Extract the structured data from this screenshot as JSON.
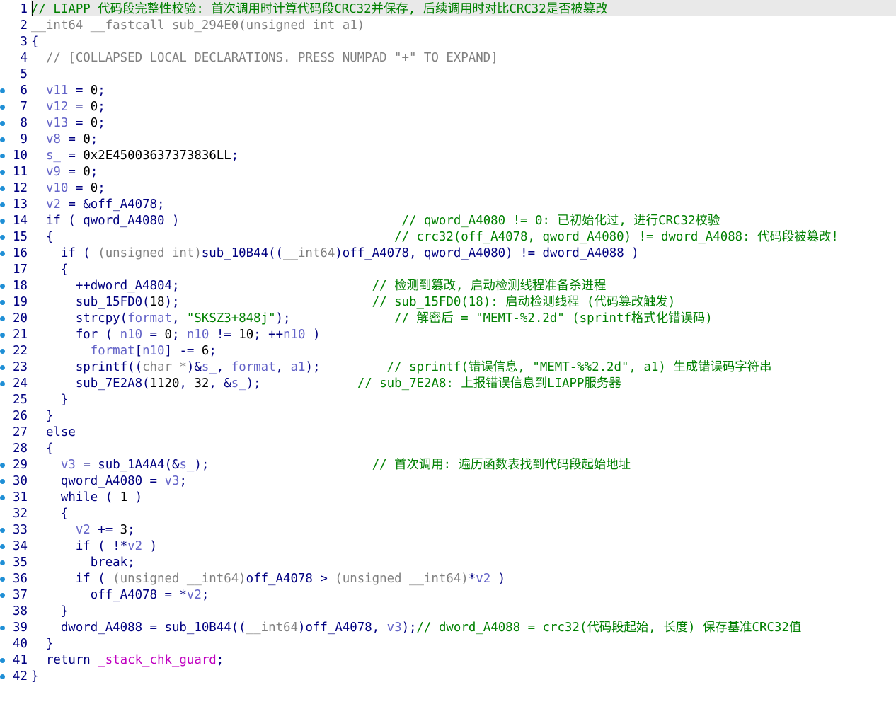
{
  "lines": [
    {
      "n": "1",
      "bp": false,
      "tokens": [
        {
          "t": "// LIAPP 代码段完整性校验: 首次调用时计算代码段CRC32并保存, 后续调用时对比CRC32是否被篡改",
          "c": "c"
        }
      ]
    },
    {
      "n": "2",
      "bp": false,
      "tokens": [
        {
          "t": "__int64 __fastcall sub_294E0(unsigned int a1)",
          "c": "t"
        }
      ]
    },
    {
      "n": "3",
      "bp": false,
      "tokens": [
        {
          "t": "{",
          "c": "p"
        }
      ]
    },
    {
      "n": "4",
      "bp": false,
      "tokens": [
        {
          "t": "  // [COLLAPSED LOCAL DECLARATIONS. PRESS NUMPAD \"+\" TO EXPAND]",
          "c": "t"
        }
      ]
    },
    {
      "n": "5",
      "bp": false,
      "tokens": []
    },
    {
      "n": "6",
      "bp": true,
      "tokens": [
        {
          "t": "  ",
          "c": "p"
        },
        {
          "t": "v11",
          "c": "v"
        },
        {
          "t": " = ",
          "c": "p"
        },
        {
          "t": "0",
          "c": "n"
        },
        {
          "t": ";",
          "c": "p"
        }
      ]
    },
    {
      "n": "7",
      "bp": true,
      "tokens": [
        {
          "t": "  ",
          "c": "p"
        },
        {
          "t": "v12",
          "c": "v"
        },
        {
          "t": " = ",
          "c": "p"
        },
        {
          "t": "0",
          "c": "n"
        },
        {
          "t": ";",
          "c": "p"
        }
      ]
    },
    {
      "n": "8",
      "bp": true,
      "tokens": [
        {
          "t": "  ",
          "c": "p"
        },
        {
          "t": "v13",
          "c": "v"
        },
        {
          "t": " = ",
          "c": "p"
        },
        {
          "t": "0",
          "c": "n"
        },
        {
          "t": ";",
          "c": "p"
        }
      ]
    },
    {
      "n": "9",
      "bp": true,
      "tokens": [
        {
          "t": "  ",
          "c": "p"
        },
        {
          "t": "v8",
          "c": "v"
        },
        {
          "t": " = ",
          "c": "p"
        },
        {
          "t": "0",
          "c": "n"
        },
        {
          "t": ";",
          "c": "p"
        }
      ]
    },
    {
      "n": "10",
      "bp": true,
      "tokens": [
        {
          "t": "  ",
          "c": "p"
        },
        {
          "t": "s_",
          "c": "v"
        },
        {
          "t": " = ",
          "c": "p"
        },
        {
          "t": "0x2E45003637373836LL",
          "c": "n"
        },
        {
          "t": ";",
          "c": "p"
        }
      ]
    },
    {
      "n": "11",
      "bp": true,
      "tokens": [
        {
          "t": "  ",
          "c": "p"
        },
        {
          "t": "v9",
          "c": "v"
        },
        {
          "t": " = ",
          "c": "p"
        },
        {
          "t": "0",
          "c": "n"
        },
        {
          "t": ";",
          "c": "p"
        }
      ]
    },
    {
      "n": "12",
      "bp": true,
      "tokens": [
        {
          "t": "  ",
          "c": "p"
        },
        {
          "t": "v10",
          "c": "v"
        },
        {
          "t": " = ",
          "c": "p"
        },
        {
          "t": "0",
          "c": "n"
        },
        {
          "t": ";",
          "c": "p"
        }
      ]
    },
    {
      "n": "13",
      "bp": true,
      "tokens": [
        {
          "t": "  ",
          "c": "p"
        },
        {
          "t": "v2",
          "c": "v"
        },
        {
          "t": " = &",
          "c": "p"
        },
        {
          "t": "off_A4078",
          "c": "g"
        },
        {
          "t": ";",
          "c": "p"
        }
      ]
    },
    {
      "n": "14",
      "bp": true,
      "tokens": [
        {
          "t": "  if ( ",
          "c": "p"
        },
        {
          "t": "qword_A4080",
          "c": "g"
        },
        {
          "t": " )",
          "c": "p"
        },
        {
          "t": "                              ",
          "c": "p"
        },
        {
          "t": "// qword_A4080 != 0: 已初始化过, 进行CRC32校验",
          "c": "s"
        }
      ]
    },
    {
      "n": "15",
      "bp": true,
      "tokens": [
        {
          "t": "  {",
          "c": "p"
        },
        {
          "t": "                                              ",
          "c": "p"
        },
        {
          "t": "// crc32(off_A4078, qword_A4080) != dword_A4088: 代码段被篡改!",
          "c": "s"
        }
      ]
    },
    {
      "n": "16",
      "bp": true,
      "tokens": [
        {
          "t": "    if ( ",
          "c": "p"
        },
        {
          "t": "(unsigned int)",
          "c": "t"
        },
        {
          "t": "sub_10B44",
          "c": "p"
        },
        {
          "t": "((",
          "c": "p"
        },
        {
          "t": "__int64",
          "c": "t"
        },
        {
          "t": ")",
          "c": "p"
        },
        {
          "t": "off_A4078",
          "c": "g"
        },
        {
          "t": ", ",
          "c": "p"
        },
        {
          "t": "qword_A4080",
          "c": "g"
        },
        {
          "t": ") != ",
          "c": "p"
        },
        {
          "t": "dword_A4088",
          "c": "g"
        },
        {
          "t": " )",
          "c": "p"
        }
      ]
    },
    {
      "n": "17",
      "bp": false,
      "tokens": [
        {
          "t": "    {",
          "c": "p"
        }
      ]
    },
    {
      "n": "18",
      "bp": true,
      "tokens": [
        {
          "t": "      ++",
          "c": "p"
        },
        {
          "t": "dword_A4804",
          "c": "g"
        },
        {
          "t": ";",
          "c": "p"
        },
        {
          "t": "                          ",
          "c": "p"
        },
        {
          "t": "// 检测到篡改, 启动检测线程准备杀进程",
          "c": "s"
        }
      ]
    },
    {
      "n": "19",
      "bp": true,
      "tokens": [
        {
          "t": "      sub_15FD0(",
          "c": "p"
        },
        {
          "t": "18",
          "c": "n"
        },
        {
          "t": ");",
          "c": "p"
        },
        {
          "t": "                          ",
          "c": "p"
        },
        {
          "t": "// sub_15FD0(18): 启动检测线程 (代码篡改触发)",
          "c": "s"
        }
      ]
    },
    {
      "n": "20",
      "bp": true,
      "tokens": [
        {
          "t": "      strcpy(",
          "c": "p"
        },
        {
          "t": "format",
          "c": "v"
        },
        {
          "t": ", ",
          "c": "p"
        },
        {
          "t": "\"SKSZ3+848j\"",
          "c": "s"
        },
        {
          "t": ");",
          "c": "p"
        },
        {
          "t": "              ",
          "c": "p"
        },
        {
          "t": "// 解密后 = \"MEMT-%2.2d\" (sprintf格式化错误码)",
          "c": "s"
        }
      ]
    },
    {
      "n": "21",
      "bp": true,
      "tokens": [
        {
          "t": "      for ( ",
          "c": "p"
        },
        {
          "t": "n10",
          "c": "v"
        },
        {
          "t": " = ",
          "c": "p"
        },
        {
          "t": "0",
          "c": "n"
        },
        {
          "t": "; ",
          "c": "p"
        },
        {
          "t": "n10",
          "c": "v"
        },
        {
          "t": " != ",
          "c": "p"
        },
        {
          "t": "10",
          "c": "n"
        },
        {
          "t": "; ++",
          "c": "p"
        },
        {
          "t": "n10",
          "c": "v"
        },
        {
          "t": " )",
          "c": "p"
        }
      ]
    },
    {
      "n": "22",
      "bp": true,
      "tokens": [
        {
          "t": "        ",
          "c": "p"
        },
        {
          "t": "format",
          "c": "v"
        },
        {
          "t": "[",
          "c": "p"
        },
        {
          "t": "n10",
          "c": "v"
        },
        {
          "t": "] -= ",
          "c": "p"
        },
        {
          "t": "6",
          "c": "n"
        },
        {
          "t": ";",
          "c": "p"
        }
      ]
    },
    {
      "n": "23",
      "bp": true,
      "tokens": [
        {
          "t": "      sprintf((",
          "c": "p"
        },
        {
          "t": "char *",
          "c": "t"
        },
        {
          "t": ")&",
          "c": "p"
        },
        {
          "t": "s_",
          "c": "v"
        },
        {
          "t": ", ",
          "c": "p"
        },
        {
          "t": "format",
          "c": "v"
        },
        {
          "t": ", ",
          "c": "p"
        },
        {
          "t": "a1",
          "c": "v"
        },
        {
          "t": ");",
          "c": "p"
        },
        {
          "t": "         ",
          "c": "p"
        },
        {
          "t": "// sprintf(错误信息, \"MEMT-%%2.2d\", a1) 生成错误码字符串",
          "c": "s"
        }
      ]
    },
    {
      "n": "24",
      "bp": true,
      "tokens": [
        {
          "t": "      sub_7E2A8(",
          "c": "p"
        },
        {
          "t": "1120",
          "c": "n"
        },
        {
          "t": ", ",
          "c": "p"
        },
        {
          "t": "32",
          "c": "n"
        },
        {
          "t": ", &",
          "c": "p"
        },
        {
          "t": "s_",
          "c": "v"
        },
        {
          "t": ");",
          "c": "p"
        },
        {
          "t": "             ",
          "c": "p"
        },
        {
          "t": "// sub_7E2A8: 上报错误信息到LIAPP服务器",
          "c": "s"
        }
      ]
    },
    {
      "n": "25",
      "bp": false,
      "tokens": [
        {
          "t": "    }",
          "c": "p"
        }
      ]
    },
    {
      "n": "26",
      "bp": false,
      "tokens": [
        {
          "t": "  }",
          "c": "p"
        }
      ]
    },
    {
      "n": "27",
      "bp": false,
      "tokens": [
        {
          "t": "  else",
          "c": "p"
        }
      ]
    },
    {
      "n": "28",
      "bp": false,
      "tokens": [
        {
          "t": "  {",
          "c": "p"
        }
      ]
    },
    {
      "n": "29",
      "bp": true,
      "tokens": [
        {
          "t": "    ",
          "c": "p"
        },
        {
          "t": "v3",
          "c": "v"
        },
        {
          "t": " = sub_1A4A4(&",
          "c": "p"
        },
        {
          "t": "s_",
          "c": "v"
        },
        {
          "t": ");",
          "c": "p"
        },
        {
          "t": "                      ",
          "c": "p"
        },
        {
          "t": "// 首次调用: 遍历函数表找到代码段起始地址",
          "c": "s"
        }
      ]
    },
    {
      "n": "30",
      "bp": true,
      "tokens": [
        {
          "t": "    ",
          "c": "p"
        },
        {
          "t": "qword_A4080",
          "c": "g"
        },
        {
          "t": " = ",
          "c": "p"
        },
        {
          "t": "v3",
          "c": "v"
        },
        {
          "t": ";",
          "c": "p"
        }
      ]
    },
    {
      "n": "31",
      "bp": true,
      "tokens": [
        {
          "t": "    while ( ",
          "c": "p"
        },
        {
          "t": "1",
          "c": "n"
        },
        {
          "t": " )",
          "c": "p"
        }
      ]
    },
    {
      "n": "32",
      "bp": false,
      "tokens": [
        {
          "t": "    {",
          "c": "p"
        }
      ]
    },
    {
      "n": "33",
      "bp": true,
      "tokens": [
        {
          "t": "      ",
          "c": "p"
        },
        {
          "t": "v2",
          "c": "v"
        },
        {
          "t": " += ",
          "c": "p"
        },
        {
          "t": "3",
          "c": "n"
        },
        {
          "t": ";",
          "c": "p"
        }
      ]
    },
    {
      "n": "34",
      "bp": true,
      "tokens": [
        {
          "t": "      if ( !*",
          "c": "p"
        },
        {
          "t": "v2",
          "c": "v"
        },
        {
          "t": " )",
          "c": "p"
        }
      ]
    },
    {
      "n": "35",
      "bp": true,
      "tokens": [
        {
          "t": "        break;",
          "c": "p"
        }
      ]
    },
    {
      "n": "36",
      "bp": true,
      "tokens": [
        {
          "t": "      if ( ",
          "c": "p"
        },
        {
          "t": "(unsigned __int64)",
          "c": "t"
        },
        {
          "t": "off_A4078",
          "c": "g"
        },
        {
          "t": " > ",
          "c": "p"
        },
        {
          "t": "(unsigned __int64)",
          "c": "t"
        },
        {
          "t": "*",
          "c": "p"
        },
        {
          "t": "v2",
          "c": "v"
        },
        {
          "t": " )",
          "c": "p"
        }
      ]
    },
    {
      "n": "37",
      "bp": true,
      "tokens": [
        {
          "t": "        ",
          "c": "p"
        },
        {
          "t": "off_A4078",
          "c": "g"
        },
        {
          "t": " = *",
          "c": "p"
        },
        {
          "t": "v2",
          "c": "v"
        },
        {
          "t": ";",
          "c": "p"
        }
      ]
    },
    {
      "n": "38",
      "bp": false,
      "tokens": [
        {
          "t": "    }",
          "c": "p"
        }
      ]
    },
    {
      "n": "39",
      "bp": true,
      "tokens": [
        {
          "t": "    ",
          "c": "p"
        },
        {
          "t": "dword_A4088",
          "c": "g"
        },
        {
          "t": " = sub_10B44((",
          "c": "p"
        },
        {
          "t": "__int64",
          "c": "t"
        },
        {
          "t": ")",
          "c": "p"
        },
        {
          "t": "off_A4078",
          "c": "g"
        },
        {
          "t": ", ",
          "c": "p"
        },
        {
          "t": "v3",
          "c": "v"
        },
        {
          "t": ");",
          "c": "p"
        },
        {
          "t": "// dword_A4088 = crc32(代码段起始, 长度) 保存基准CRC32值",
          "c": "s"
        }
      ]
    },
    {
      "n": "40",
      "bp": false,
      "tokens": [
        {
          "t": "  }",
          "c": "p"
        }
      ]
    },
    {
      "n": "41",
      "bp": true,
      "tokens": [
        {
          "t": "  return ",
          "c": "p"
        },
        {
          "t": "_stack_chk_guard",
          "c": "m"
        },
        {
          "t": ";",
          "c": "p"
        }
      ]
    },
    {
      "n": "42",
      "bp": true,
      "tokens": [
        {
          "t": "}",
          "c": "p"
        }
      ]
    }
  ]
}
